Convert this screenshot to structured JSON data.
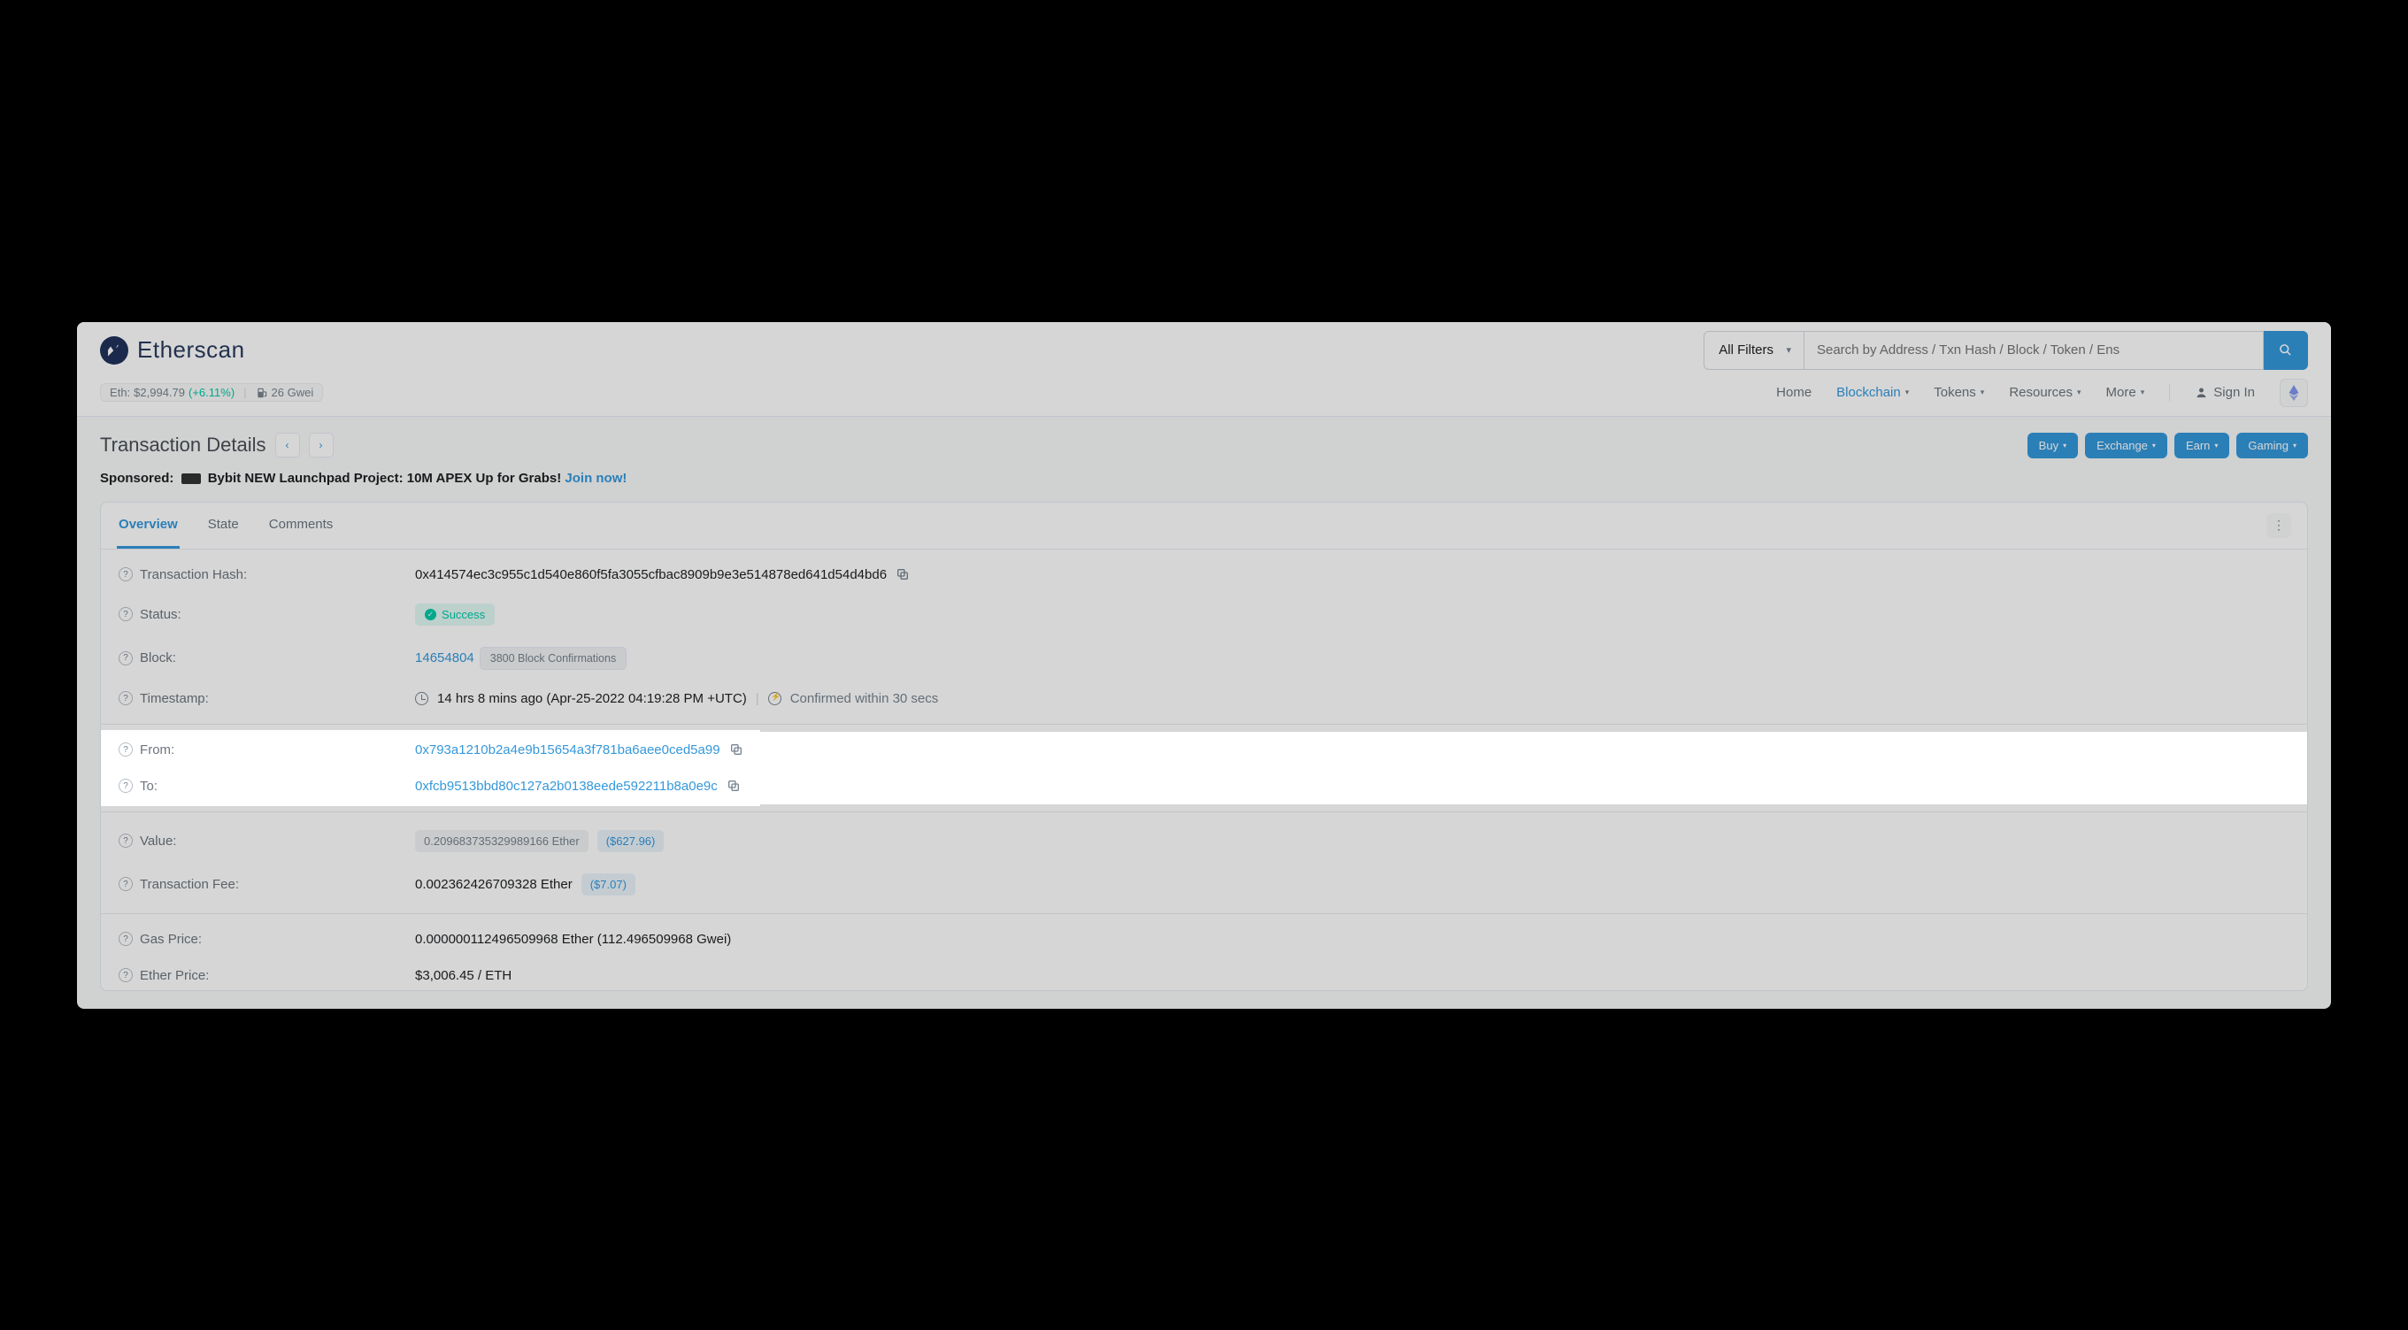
{
  "brand": "Etherscan",
  "header": {
    "filter_label": "All Filters",
    "search_placeholder": "Search by Address / Txn Hash / Block / Token / Ens"
  },
  "priceBar": {
    "label": "Eth:",
    "price": "$2,994.79",
    "change": "(+6.11%)",
    "gwei": "26 Gwei"
  },
  "nav": {
    "home": "Home",
    "blockchain": "Blockchain",
    "tokens": "Tokens",
    "resources": "Resources",
    "more": "More",
    "signin": "Sign In"
  },
  "page": {
    "title": "Transaction Details",
    "actions": {
      "buy": "Buy",
      "exchange": "Exchange",
      "earn": "Earn",
      "gaming": "Gaming"
    }
  },
  "sponsor": {
    "prefix": "Sponsored:",
    "text": "Bybit NEW Launchpad Project: 10M APEX Up for Grabs!",
    "link": "Join now!"
  },
  "tabs": {
    "overview": "Overview",
    "state": "State",
    "comments": "Comments"
  },
  "labels": {
    "txhash": "Transaction Hash:",
    "status": "Status:",
    "block": "Block:",
    "timestamp": "Timestamp:",
    "from": "From:",
    "to": "To:",
    "value": "Value:",
    "txfee": "Transaction Fee:",
    "gasprice": "Gas Price:",
    "ethprice": "Ether Price:"
  },
  "values": {
    "txhash": "0x414574ec3c955c1d540e860f5fa3055cfbac8909b9e3e514878ed641d54d4bd6",
    "status": "Success",
    "block": "14654804",
    "block_conf": "3800 Block Confirmations",
    "timestamp": "14 hrs 8 mins ago (Apr-25-2022 04:19:28 PM +UTC)",
    "confirmed_in": "Confirmed within 30 secs",
    "from": "0x793a1210b2a4e9b15654a3f781ba6aee0ced5a99",
    "to": "0xfcb9513bbd80c127a2b0138eede592211b8a0e9c",
    "value_eth": "0.209683735329989166 Ether",
    "value_usd": "($627.96)",
    "txfee_eth": "0.002362426709328 Ether",
    "txfee_usd": "($7.07)",
    "gasprice": "0.000000112496509968 Ether (112.496509968 Gwei)",
    "ethprice": "$3,006.45 / ETH"
  }
}
